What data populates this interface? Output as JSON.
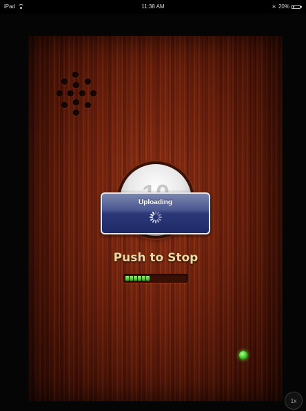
{
  "status_bar": {
    "device": "iPad",
    "time": "11:38 AM",
    "battery": "20%",
    "battery_level": 0.2
  },
  "app": {
    "counter": "10",
    "push_label": "Push to Stop",
    "progress_fraction": 0.4
  },
  "dialog": {
    "title": "Uploading"
  },
  "zoom": {
    "label": "1x"
  },
  "icons": {
    "wifi": "wifi-icon",
    "bluetooth": "bluetooth-icon",
    "battery": "battery-icon",
    "spinner": "activity-spinner-icon",
    "led": "status-led-icon"
  },
  "colors": {
    "label": "#f2d9a0",
    "led": "#3cc42a",
    "dialog": "#2c3878",
    "progress": "#36a82a"
  }
}
